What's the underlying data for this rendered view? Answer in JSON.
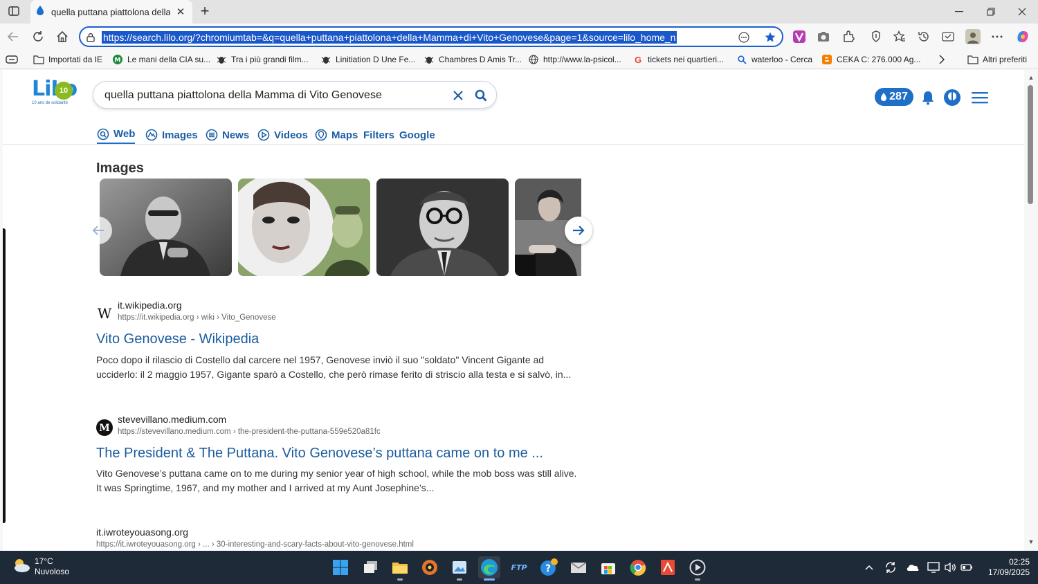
{
  "browser": {
    "tab_title": "quella puttana piattolona della M",
    "url": "https://search.lilo.org/?chromiumtab=&q=quella+puttana+piattolona+della+Mamma+di+Vito+Genovese&page=1&source=lilo_home_n"
  },
  "bookmarks": [
    {
      "label": "Importati da IE",
      "icon": "folder-icon"
    },
    {
      "label": "Le mani della CIA su...",
      "icon": "m-icon"
    },
    {
      "label": "Tra i più grandi film...",
      "icon": "bug-icon"
    },
    {
      "label": "Linitiation D Une Fe...",
      "icon": "bug-icon"
    },
    {
      "label": "Chambres D Amis Tr...",
      "icon": "bug-icon"
    },
    {
      "label": "http://www.la-psicol...",
      "icon": "globe-icon"
    },
    {
      "label": "tickets nei quartieri...",
      "icon": "google-icon"
    },
    {
      "label": "waterloo - Cerca",
      "icon": "search-icon"
    },
    {
      "label": "CEKA C: 276.000 Ag...",
      "icon": "blogger-icon"
    }
  ],
  "other_bookmarks": "Altri preferiti",
  "lilo": {
    "logo_text": "LiLo",
    "logo_badge": "10",
    "logo_tagline": "10 ans de solidarité",
    "search_query": "quella puttana piattolona della Mamma di Vito Genovese",
    "drops_count": "287",
    "tabs": [
      {
        "label": "Web",
        "active": true
      },
      {
        "label": "Images"
      },
      {
        "label": "News"
      },
      {
        "label": "Videos"
      },
      {
        "label": "Maps"
      },
      {
        "label": "Filters"
      },
      {
        "label": "Google"
      }
    ],
    "images_heading": "Images"
  },
  "results": [
    {
      "domain": "it.wikipedia.org",
      "path": "https://it.wikipedia.org › wiki › Vito_Genovese",
      "title": "Vito Genovese - Wikipedia",
      "snippet": "Poco dopo il rilascio di Costello dal carcere nel 1957, Genovese inviò il suo \"soldato\" Vincent Gigante ad ucciderlo: il 2 maggio 1957, Gigante sparò a Costello, che però rimase ferito di striscio alla testa e si salvò, in..."
    },
    {
      "domain": "stevevillano.medium.com",
      "path": "https://stevevillano.medium.com › the-president-the-puttana-559e520a81fc",
      "title": "The President & The Puttana. Vito Genovese’s puttana came on to me ...",
      "snippet": "Vito Genovese’s puttana came on to me during my senior year of high school, while the mob boss was still alive. It was Springtime, 1967, and my mother and I arrived at my Aunt Josephine’s..."
    },
    {
      "domain": "it.iwroteyouasong.org",
      "path": "https://it.iwroteyouasong.org › ... › 30-interesting-and-scary-facts-about-vito-genovese.html"
    }
  ],
  "taskbar": {
    "temperature": "17°C",
    "weather": "Nuvoloso",
    "time": "02:25",
    "date": "17/09/2025"
  },
  "colors": {
    "accent": "#1a5fd0",
    "lilo_blue": "#1f6fc7",
    "lilo_green": "#8ab920",
    "link": "#1b5c9e"
  }
}
